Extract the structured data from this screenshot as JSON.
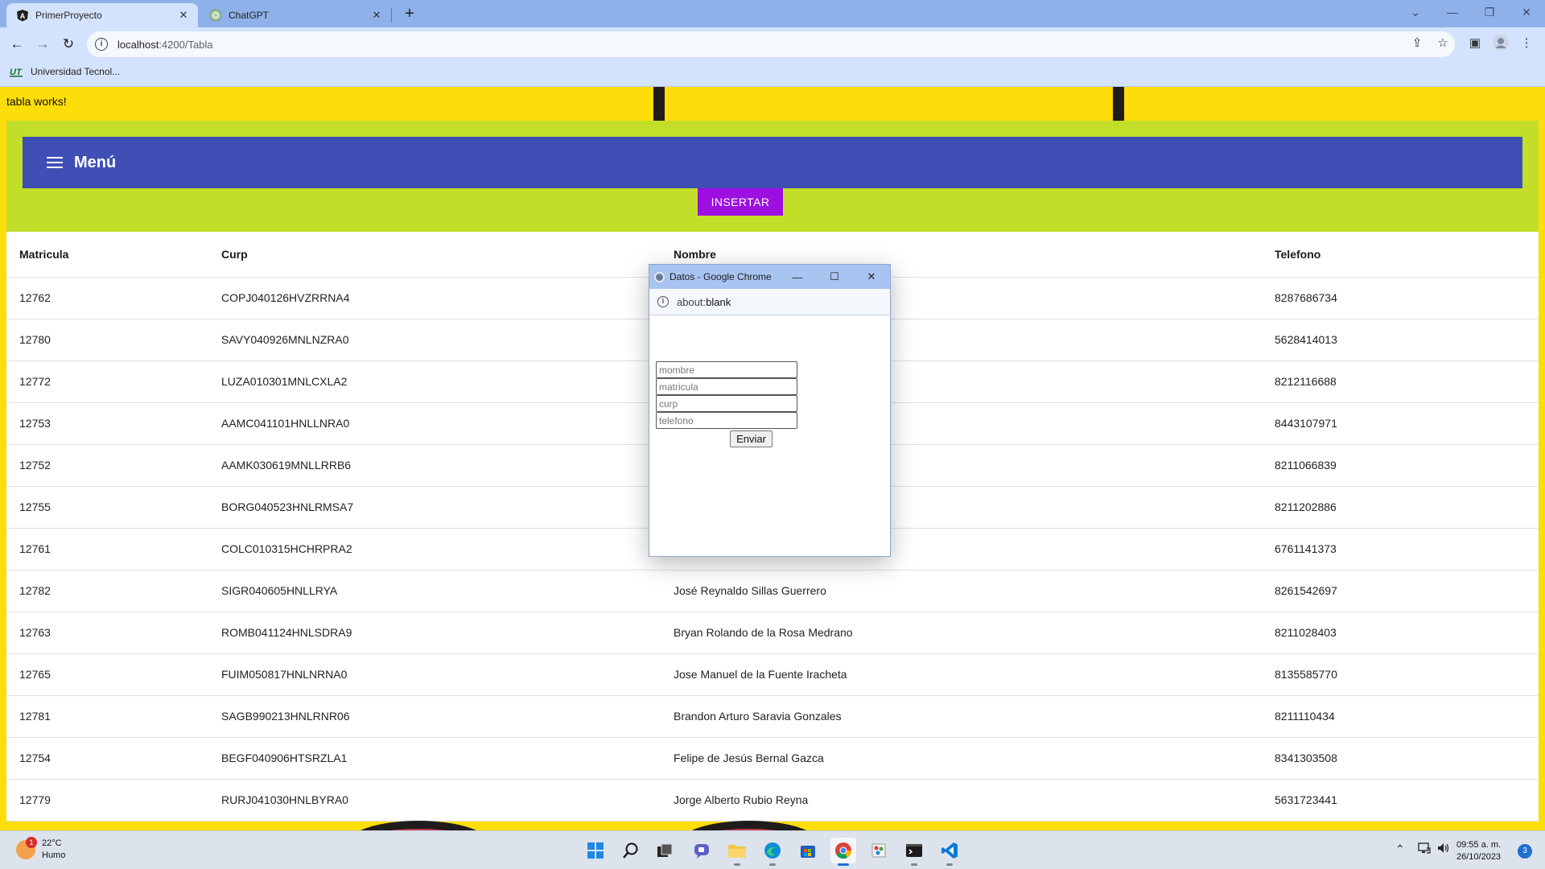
{
  "browser": {
    "tabs": [
      {
        "title": "PrimerProyecto",
        "active": true,
        "icon": "angular-icon"
      },
      {
        "title": "ChatGPT",
        "active": false,
        "icon": "chatgpt-icon"
      }
    ],
    "url_host": "localhost",
    "url_path": ":4200/Tabla",
    "bookmarks": [
      {
        "label": "Universidad Tecnol..."
      }
    ]
  },
  "page": {
    "tabla_works": "tabla works!",
    "menu_title": "Menú",
    "insert_label": "INSERTAR",
    "colors": {
      "page_bg": "#fddd0a",
      "green": "#c2de29",
      "menu_bar": "#3f4fb5",
      "insert_button": "#9d0fe0"
    }
  },
  "table": {
    "headers": [
      "Matricula",
      "Curp",
      "Nombre",
      "Telefono"
    ],
    "rows": [
      [
        "12762",
        "COPJ040126HVZRRNA4",
        "",
        "8287686734"
      ],
      [
        "12780",
        "SAVY040926MNLNZRA0",
        "",
        "5628414013"
      ],
      [
        "12772",
        "LUZA010301MNLCXLA2",
        "",
        "8212116688"
      ],
      [
        "12753",
        "AAMC041101HNLLNRA0",
        "",
        "8443107971"
      ],
      [
        "12752",
        "AAMK030619MNLLRRB6",
        "",
        "8211066839"
      ],
      [
        "12755",
        "BORG040523HNLRMSA7",
        "",
        "8211202886"
      ],
      [
        "12761",
        "COLC010315HCHRPRA2",
        "",
        "6761141373"
      ],
      [
        "12782",
        "SIGR040605HNLLRYA",
        "José Reynaldo Sillas Guerrero",
        "8261542697"
      ],
      [
        "12763",
        "ROMB041124HNLSDRA9",
        "Bryan Rolando de la Rosa Medrano",
        "8211028403"
      ],
      [
        "12765",
        "FUIM050817HNLNRNA0",
        "Jose Manuel de la Fuente Iracheta",
        "8135585770"
      ],
      [
        "12781",
        "SAGB990213HNLRNR06",
        "Brandon Arturo Saravia Gonzales",
        "8211110434"
      ],
      [
        "12754",
        "BEGF040906HTSRZLA1",
        "Felipe de Jesús Bernal Gazca",
        "8341303508"
      ],
      [
        "12779",
        "RURJ041030HNLBYRA0",
        "Jorge Alberto Rubio Reyna",
        "5631723441"
      ]
    ]
  },
  "popup": {
    "title": "Datos - Google Chrome",
    "address_prefix": "about:",
    "address_rest": "blank",
    "fields": [
      {
        "name": "mombre-field",
        "placeholder": "mombre",
        "value": ""
      },
      {
        "name": "matricula-field",
        "placeholder": "matricula",
        "value": ""
      },
      {
        "name": "curp-field",
        "placeholder": "curp",
        "value": ""
      },
      {
        "name": "telefono-field",
        "placeholder": "telefono",
        "value": ""
      }
    ],
    "submit_label": "Enviar"
  },
  "taskbar": {
    "weather_temp": "22°C",
    "weather_desc": "Humo",
    "weather_badge": "1",
    "apps": [
      "windows-start-icon",
      "search-icon",
      "task-view-icon",
      "teams-chat-icon",
      "file-explorer-icon",
      "edge-icon",
      "store-icon",
      "chrome-icon",
      "paint-icon",
      "terminal-icon",
      "vscode-icon"
    ],
    "time": "09:55 a. m.",
    "date": "26/10/2023",
    "notifications": "3"
  }
}
